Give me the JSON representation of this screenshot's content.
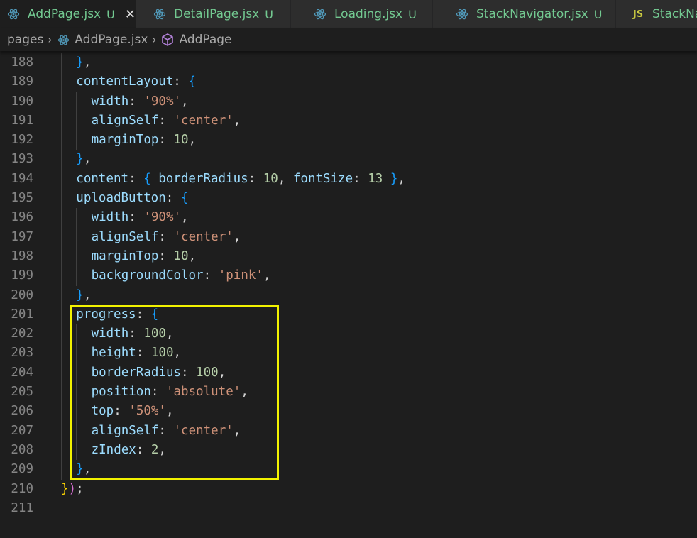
{
  "tabs": [
    {
      "name": "AddPage.jsx",
      "status": "U",
      "icon": "react-icon",
      "active": true,
      "close": "✕"
    },
    {
      "name": "DetailPage.jsx",
      "status": "U",
      "icon": "react-icon",
      "active": false
    },
    {
      "name": "Loading.jsx",
      "status": "U",
      "icon": "react-icon",
      "active": false
    },
    {
      "name": "StackNavigator.jsx",
      "status": "U",
      "icon": "react-icon",
      "active": false
    },
    {
      "name": "StackNav",
      "status": "",
      "icon": "js-icon",
      "icon_text": "JS",
      "active": false
    }
  ],
  "breadcrumb": {
    "folder": "pages",
    "file": "AddPage.jsx",
    "symbol": "AddPage",
    "separator": "›"
  },
  "code": {
    "lines": [
      {
        "number": "188",
        "indent": 1,
        "tokens": [
          {
            "t": "}",
            "c": "b2"
          },
          {
            "t": ",",
            "c": "o"
          }
        ]
      },
      {
        "number": "189",
        "indent": 1,
        "tokens": [
          {
            "t": "contentLayout",
            "c": "p"
          },
          {
            "t": ": ",
            "c": "o"
          },
          {
            "t": "{",
            "c": "b2"
          }
        ]
      },
      {
        "number": "190",
        "indent": 2,
        "tokens": [
          {
            "t": "width",
            "c": "p"
          },
          {
            "t": ": ",
            "c": "o"
          },
          {
            "t": "'90%'",
            "c": "s"
          },
          {
            "t": ",",
            "c": "o"
          }
        ]
      },
      {
        "number": "191",
        "indent": 2,
        "tokens": [
          {
            "t": "alignSelf",
            "c": "p"
          },
          {
            "t": ": ",
            "c": "o"
          },
          {
            "t": "'center'",
            "c": "s"
          },
          {
            "t": ",",
            "c": "o"
          }
        ]
      },
      {
        "number": "192",
        "indent": 2,
        "tokens": [
          {
            "t": "marginTop",
            "c": "p"
          },
          {
            "t": ": ",
            "c": "o"
          },
          {
            "t": "10",
            "c": "n"
          },
          {
            "t": ",",
            "c": "o"
          }
        ]
      },
      {
        "number": "193",
        "indent": 1,
        "tokens": [
          {
            "t": "}",
            "c": "b2"
          },
          {
            "t": ",",
            "c": "o"
          }
        ]
      },
      {
        "number": "194",
        "indent": 1,
        "tokens": [
          {
            "t": "content",
            "c": "p"
          },
          {
            "t": ": ",
            "c": "o"
          },
          {
            "t": "{",
            "c": "b2"
          },
          {
            "t": " borderRadius",
            "c": "p"
          },
          {
            "t": ": ",
            "c": "o"
          },
          {
            "t": "10",
            "c": "n"
          },
          {
            "t": ", ",
            "c": "o"
          },
          {
            "t": "fontSize",
            "c": "p"
          },
          {
            "t": ": ",
            "c": "o"
          },
          {
            "t": "13",
            "c": "n"
          },
          {
            "t": " ",
            "c": "o"
          },
          {
            "t": "}",
            "c": "b2"
          },
          {
            "t": ",",
            "c": "o"
          }
        ]
      },
      {
        "number": "195",
        "indent": 1,
        "tokens": [
          {
            "t": "uploadButton",
            "c": "p"
          },
          {
            "t": ": ",
            "c": "o"
          },
          {
            "t": "{",
            "c": "b2"
          }
        ]
      },
      {
        "number": "196",
        "indent": 2,
        "tokens": [
          {
            "t": "width",
            "c": "p"
          },
          {
            "t": ": ",
            "c": "o"
          },
          {
            "t": "'90%'",
            "c": "s"
          },
          {
            "t": ",",
            "c": "o"
          }
        ]
      },
      {
        "number": "197",
        "indent": 2,
        "tokens": [
          {
            "t": "alignSelf",
            "c": "p"
          },
          {
            "t": ": ",
            "c": "o"
          },
          {
            "t": "'center'",
            "c": "s"
          },
          {
            "t": ",",
            "c": "o"
          }
        ]
      },
      {
        "number": "198",
        "indent": 2,
        "tokens": [
          {
            "t": "marginTop",
            "c": "p"
          },
          {
            "t": ": ",
            "c": "o"
          },
          {
            "t": "10",
            "c": "n"
          },
          {
            "t": ",",
            "c": "o"
          }
        ]
      },
      {
        "number": "199",
        "indent": 2,
        "tokens": [
          {
            "t": "backgroundColor",
            "c": "p"
          },
          {
            "t": ": ",
            "c": "o"
          },
          {
            "t": "'pink'",
            "c": "s"
          },
          {
            "t": ",",
            "c": "o"
          }
        ]
      },
      {
        "number": "200",
        "indent": 1,
        "tokens": [
          {
            "t": "}",
            "c": "b2"
          },
          {
            "t": ",",
            "c": "o"
          }
        ]
      },
      {
        "number": "201",
        "indent": 1,
        "tokens": [
          {
            "t": "progress",
            "c": "p"
          },
          {
            "t": ": ",
            "c": "o"
          },
          {
            "t": "{",
            "c": "b2"
          }
        ]
      },
      {
        "number": "202",
        "indent": 2,
        "tokens": [
          {
            "t": "width",
            "c": "p"
          },
          {
            "t": ": ",
            "c": "o"
          },
          {
            "t": "100",
            "c": "n"
          },
          {
            "t": ",",
            "c": "o"
          }
        ]
      },
      {
        "number": "203",
        "indent": 2,
        "tokens": [
          {
            "t": "height",
            "c": "p"
          },
          {
            "t": ": ",
            "c": "o"
          },
          {
            "t": "100",
            "c": "n"
          },
          {
            "t": ",",
            "c": "o"
          }
        ]
      },
      {
        "number": "204",
        "indent": 2,
        "tokens": [
          {
            "t": "borderRadius",
            "c": "p"
          },
          {
            "t": ": ",
            "c": "o"
          },
          {
            "t": "100",
            "c": "n"
          },
          {
            "t": ",",
            "c": "o"
          }
        ]
      },
      {
        "number": "205",
        "indent": 2,
        "tokens": [
          {
            "t": "position",
            "c": "p"
          },
          {
            "t": ": ",
            "c": "o"
          },
          {
            "t": "'absolute'",
            "c": "s"
          },
          {
            "t": ",",
            "c": "o"
          }
        ]
      },
      {
        "number": "206",
        "indent": 2,
        "tokens": [
          {
            "t": "top",
            "c": "p"
          },
          {
            "t": ": ",
            "c": "o"
          },
          {
            "t": "'50%'",
            "c": "s"
          },
          {
            "t": ",",
            "c": "o"
          }
        ]
      },
      {
        "number": "207",
        "indent": 2,
        "tokens": [
          {
            "t": "alignSelf",
            "c": "p"
          },
          {
            "t": ": ",
            "c": "o"
          },
          {
            "t": "'center'",
            "c": "s"
          },
          {
            "t": ",",
            "c": "o"
          }
        ]
      },
      {
        "number": "208",
        "indent": 2,
        "tokens": [
          {
            "t": "zIndex",
            "c": "p"
          },
          {
            "t": ": ",
            "c": "o"
          },
          {
            "t": "2",
            "c": "n"
          },
          {
            "t": ",",
            "c": "o"
          }
        ]
      },
      {
        "number": "209",
        "indent": 1,
        "tokens": [
          {
            "t": "}",
            "c": "b2"
          },
          {
            "t": ",",
            "c": "o"
          }
        ]
      },
      {
        "number": "210",
        "indent": 0,
        "tokens": [
          {
            "t": "}",
            "c": "b3"
          },
          {
            "t": ")",
            "c": "b1"
          },
          {
            "t": ";",
            "c": "o"
          }
        ]
      },
      {
        "number": "211",
        "indent": 0,
        "tokens": []
      }
    ]
  },
  "colors": {
    "editor_background": "#1e1e1e",
    "highlight_box": "#f2f200",
    "untracked_file": "#73c991"
  }
}
